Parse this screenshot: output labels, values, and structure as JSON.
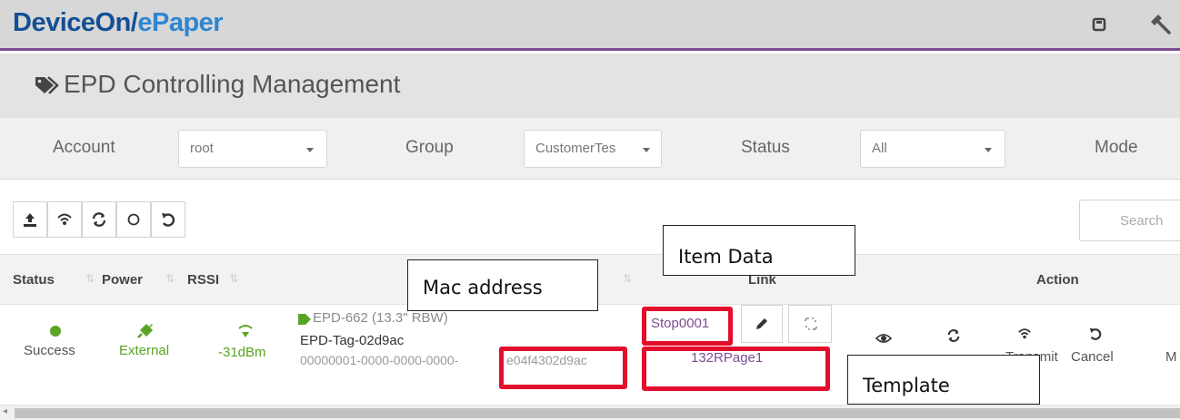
{
  "app": {
    "brand_part1": "DeviceOn/",
    "brand_part2": "ePaper"
  },
  "page": {
    "title": "EPD Controlling Management"
  },
  "filters": {
    "account_label": "Account",
    "account_value": "root",
    "group_label": "Group",
    "group_value": "CustomerTes",
    "status_label": "Status",
    "status_value": "All",
    "mode_label": "Mode"
  },
  "toolbar": {
    "search_placeholder": "Search"
  },
  "table": {
    "headers": {
      "status": "Status",
      "power": "Power",
      "rssi": "RSSI",
      "link": "Link",
      "action": "Action"
    },
    "rows": [
      {
        "status": "Success",
        "power": "External",
        "rssi": "-31dBm",
        "device_name": "EPD-662 (13.3\" RBW)",
        "tag_name": "EPD-Tag-02d9ac",
        "mac_prefix": "00000001-0000-0000-0000-",
        "mac_suffix": "e04f4302d9ac",
        "item_data": "Stop0001",
        "template": "132RPage1",
        "actions": [
          "Transmit",
          "Cancel",
          "M"
        ]
      }
    ]
  },
  "annotations": {
    "item_data": "Item Data",
    "mac_address": "Mac address",
    "template": "Template"
  },
  "colors": {
    "brand_dark": "#134f95",
    "brand_light": "#2e86d1",
    "accent": "#7d4c93",
    "success": "#5aa424",
    "highlight": "#e30e2c"
  }
}
